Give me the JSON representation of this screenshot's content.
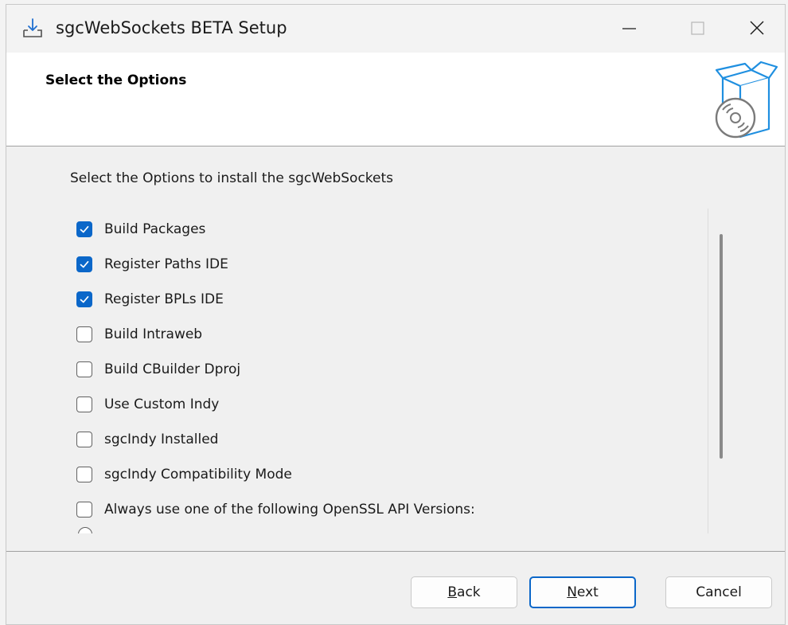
{
  "window": {
    "title": "sgcWebSockets BETA Setup",
    "icon": "installer-download-icon",
    "controls": {
      "minimize": "minimize-icon",
      "maximize": "maximize-icon",
      "close": "close-icon"
    }
  },
  "header": {
    "title": "Select the Options",
    "icon": "software-box-cd-icon"
  },
  "content": {
    "instruction": "Select the Options to install the sgcWebSockets",
    "options": [
      {
        "label": "Build Packages",
        "checked": true
      },
      {
        "label": "Register Paths IDE",
        "checked": true
      },
      {
        "label": "Register BPLs IDE",
        "checked": true
      },
      {
        "label": "Build Intraweb",
        "checked": false
      },
      {
        "label": "Build CBuilder Dproj",
        "checked": false
      },
      {
        "label": "Use Custom Indy",
        "checked": false
      },
      {
        "label": "sgcIndy Installed",
        "checked": false
      },
      {
        "label": "sgcIndy Compatibility Mode",
        "checked": false
      },
      {
        "label": "Always use one of the following OpenSSL API Versions:",
        "checked": false
      }
    ]
  },
  "buttons": {
    "back_mnemonic": "B",
    "back_rest": "ack",
    "next_mnemonic": "N",
    "next_rest": "ext",
    "cancel": "Cancel"
  },
  "colors": {
    "accent": "#0b67c9",
    "header_bg": "#ffffff",
    "body_bg": "#f0f0f0"
  }
}
